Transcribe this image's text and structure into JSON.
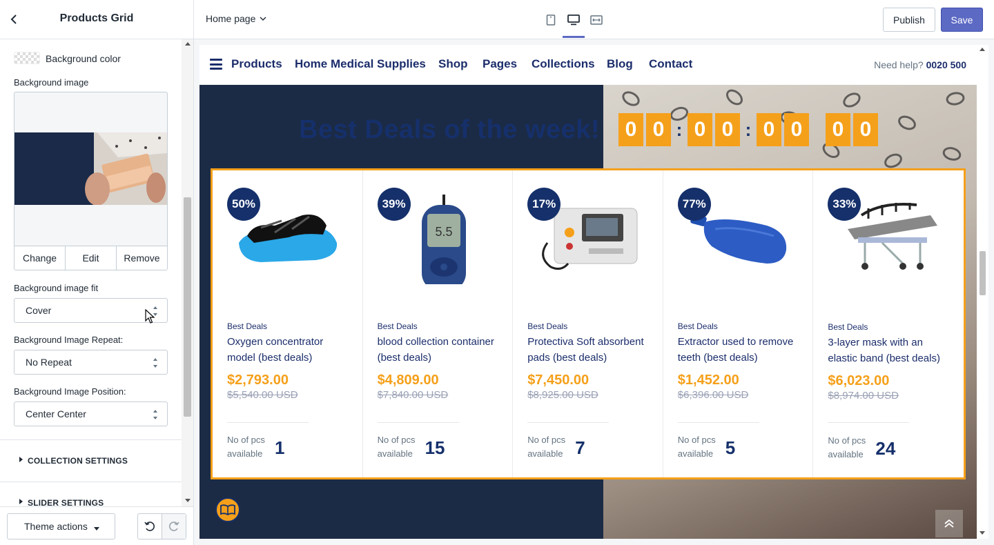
{
  "sidebar": {
    "title": "Products Grid",
    "background_color_label": "Background color",
    "background_image_label": "Background image",
    "image_actions": {
      "change": "Change",
      "edit": "Edit",
      "remove": "Remove"
    },
    "fit": {
      "label": "Background image fit",
      "value": "Cover"
    },
    "repeat": {
      "label": "Background Image Repeat:",
      "value": "No Repeat"
    },
    "position": {
      "label": "Background Image Position:",
      "value": "Center Center"
    },
    "sections": [
      "COLLECTION SETTINGS",
      "SLIDER SETTINGS"
    ],
    "footer": {
      "theme_actions": "Theme actions"
    }
  },
  "topbar": {
    "page_select": "Home page",
    "devices": [
      "mobile-icon",
      "desktop-icon",
      "fullwidth-icon"
    ],
    "publish": "Publish",
    "save": "Save"
  },
  "store": {
    "nav": [
      "Products",
      "Home Medical Supplies",
      "Shop",
      "Pages",
      "Collections",
      "Blog",
      "Contact"
    ],
    "help_label": "Need help?",
    "help_phone": "0020 500",
    "hero_title": "Best Deals of the week!",
    "countdown": [
      "0",
      "0",
      "0",
      "0",
      "0",
      "0",
      "0",
      "0"
    ],
    "colors": {
      "navy": "#15306b",
      "orange": "#f5a01a",
      "accent": "#5c6ac4"
    },
    "products": [
      {
        "discount": "50%",
        "category": "Best Deals",
        "name": "Oxygen concentrator model (best deals)",
        "price": "$2,793.00",
        "old_price": "$5,540.00 USD",
        "avail_label": "No of pcs available",
        "count": "1",
        "image": "shoe-covers"
      },
      {
        "discount": "39%",
        "category": "Best Deals",
        "name": "blood collection container (best deals)",
        "price": "$4,809.00",
        "old_price": "$7,840.00 USD",
        "avail_label": "No of pcs available",
        "count": "15",
        "image": "glucometer"
      },
      {
        "discount": "17%",
        "category": "Best Deals",
        "name": "Protectiva Soft absorbent pads (best deals)",
        "price": "$7,450.00",
        "old_price": "$8,925.00 USD",
        "avail_label": "No of pcs available",
        "count": "7",
        "image": "defibrillator"
      },
      {
        "discount": "77%",
        "category": "Best Deals",
        "name": "Extractor used to remove teeth (best deals)",
        "price": "$1,452.00",
        "old_price": "$6,396.00 USD",
        "avail_label": "No of pcs available",
        "count": "5",
        "image": "hot-water-bottle"
      },
      {
        "discount": "33%",
        "category": "Best Deals",
        "name": "3-layer mask with an elastic band (best deals)",
        "price": "$6,023.00",
        "old_price": "$8,974.00 USD",
        "avail_label": "No of pcs available",
        "count": "24",
        "image": "stretcher"
      }
    ]
  }
}
